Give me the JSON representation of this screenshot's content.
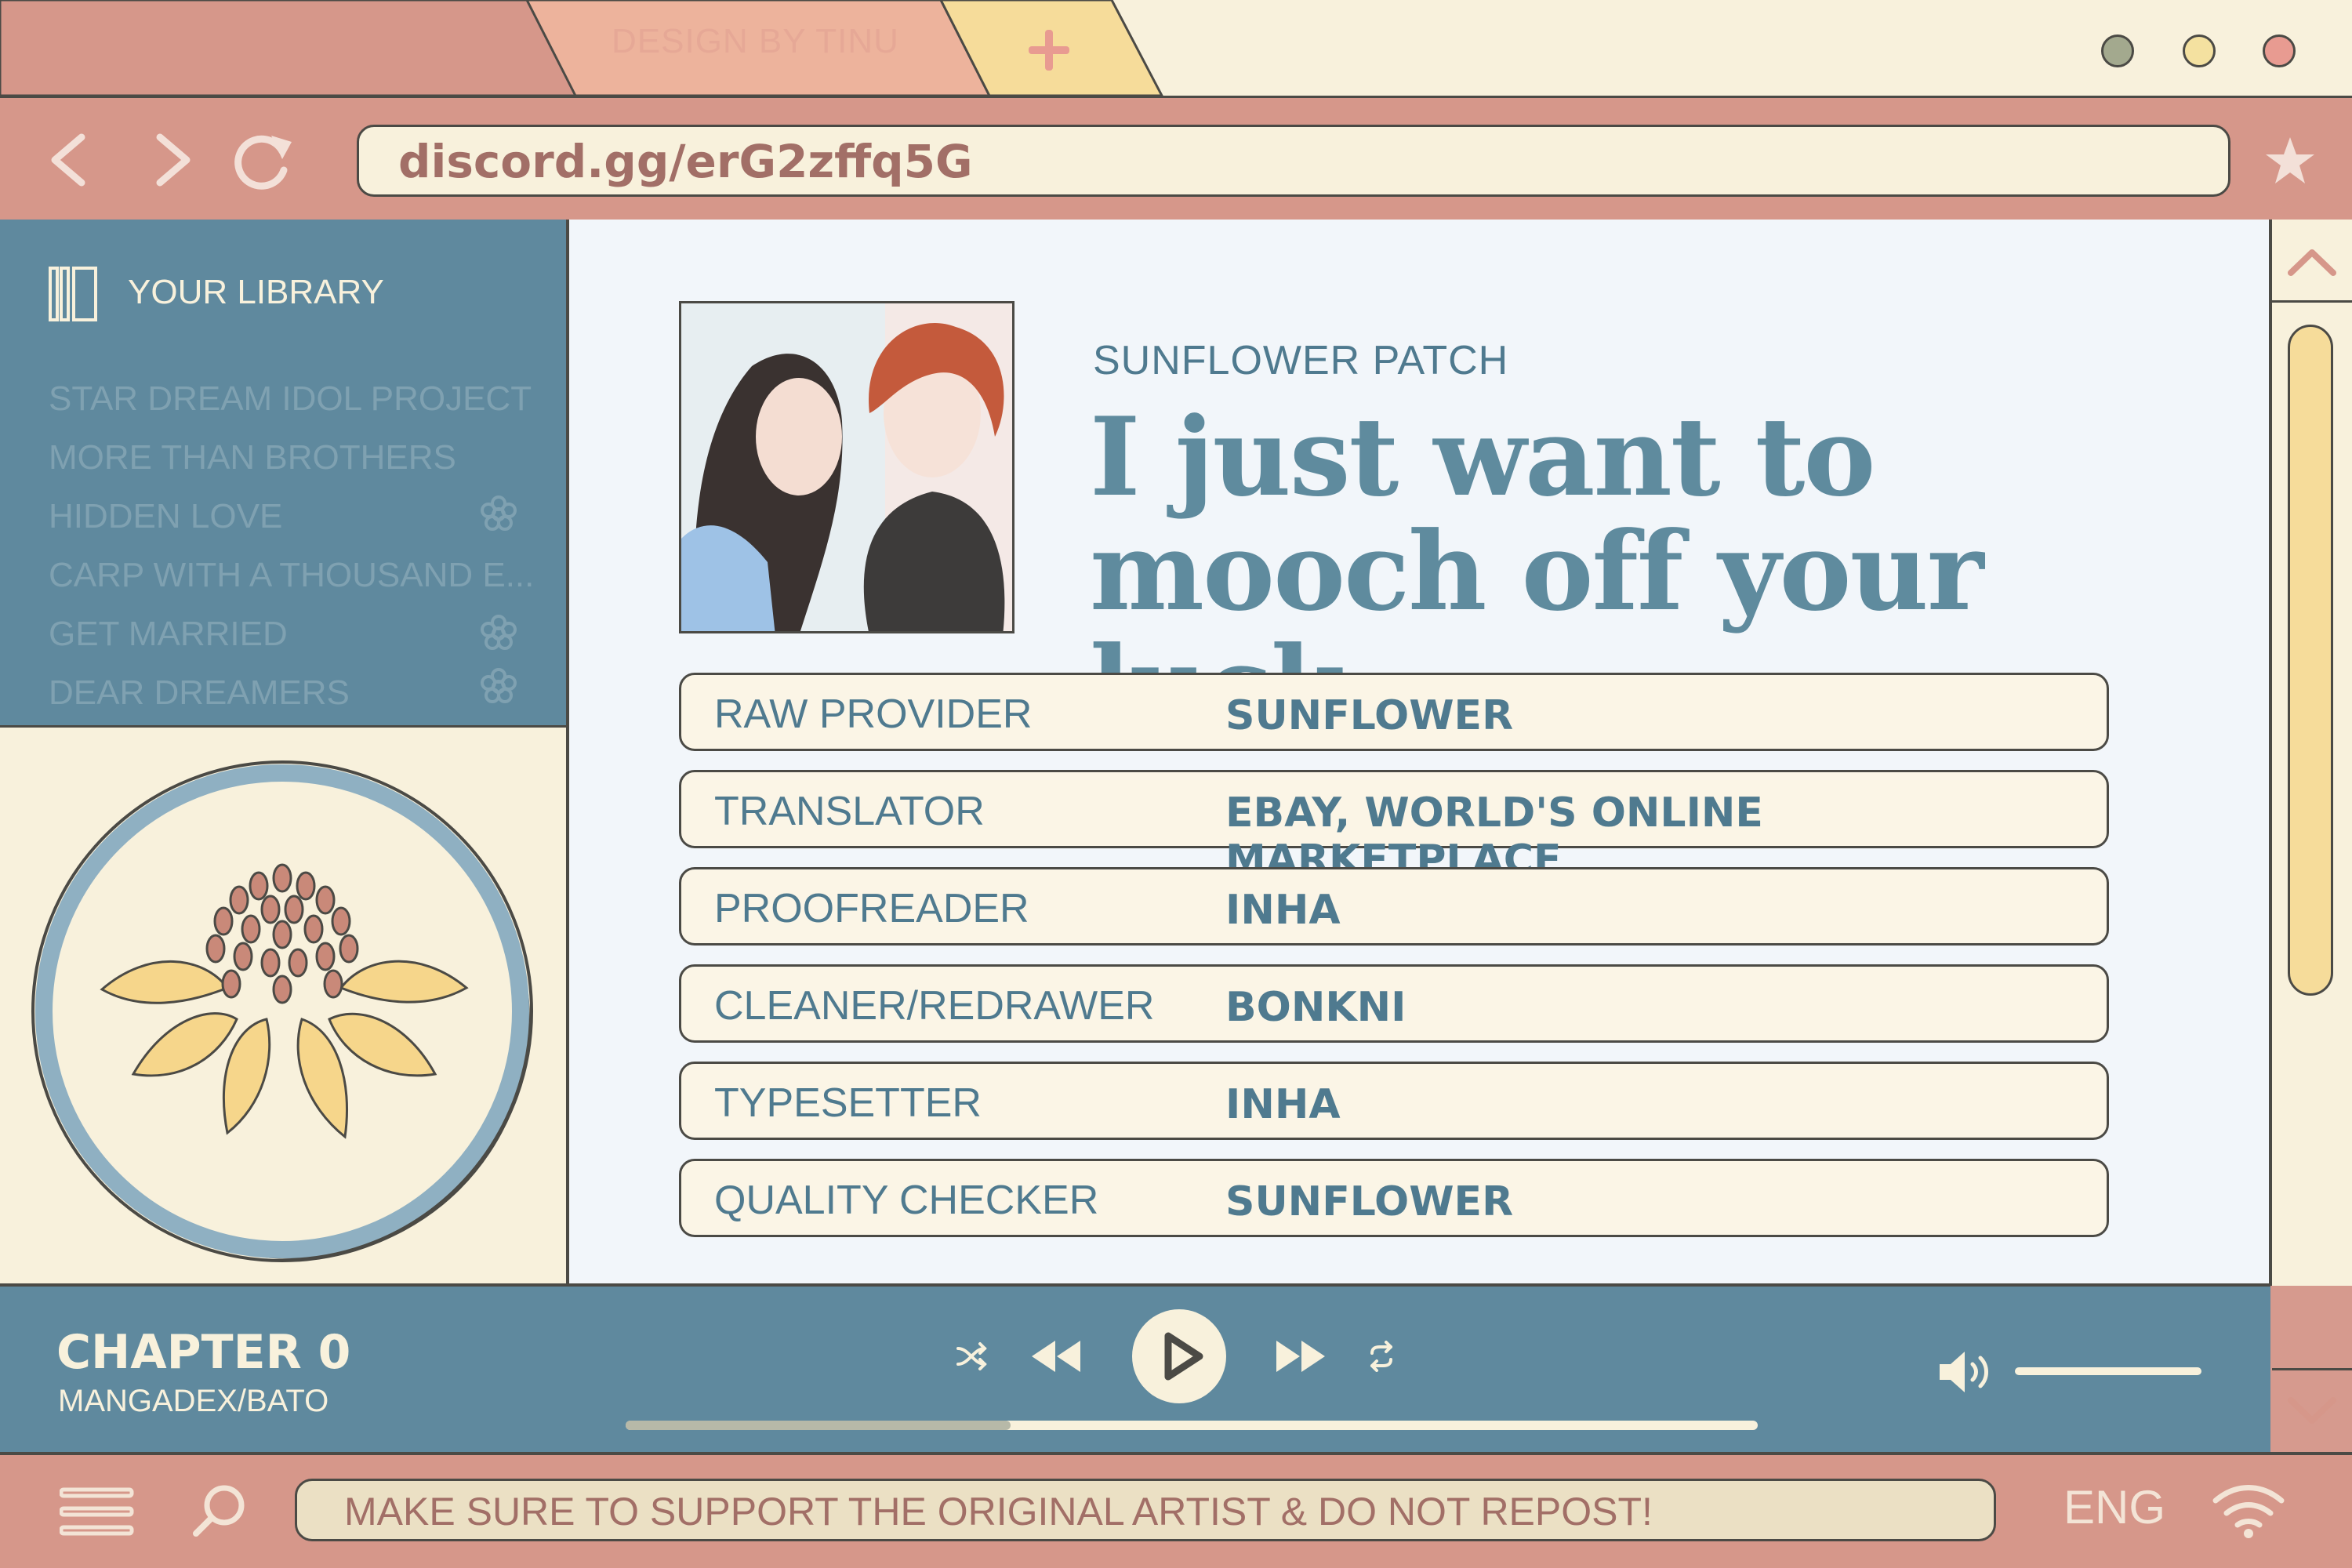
{
  "window": {
    "tab_label": "DESIGN BY TINU",
    "new_tab_symbol": "+",
    "dots": [
      "#a3a98e",
      "#f4e1a0",
      "#e89b91"
    ]
  },
  "nav": {
    "back_icon": "chevron-left-icon",
    "forward_icon": "chevron-right-icon",
    "reload_icon": "reload-icon",
    "url": "discord.gg/erG2zffq5G",
    "bookmark_icon": "star-icon"
  },
  "sidebar": {
    "title": "YOUR LIBRARY",
    "items": [
      {
        "label": "STAR DREAM IDOL PROJECT",
        "flower": false
      },
      {
        "label": "MORE THAN BROTHERS",
        "flower": false
      },
      {
        "label": "HIDDEN LOVE",
        "flower": true
      },
      {
        "label": "CARP WITH A THOUSAND E...",
        "flower": false
      },
      {
        "label": "GET MARRIED",
        "flower": true
      },
      {
        "label": "DEAR DREAMERS",
        "flower": true
      }
    ]
  },
  "main": {
    "group": "SUNFLOWER PATCH",
    "title": "I just want to mooch off your luck",
    "credits": [
      {
        "role": "RAW PROVIDER",
        "name": "SUNFLOWER"
      },
      {
        "role": "TRANSLATOR",
        "name": "EBAY, WORLD'S ONLINE MARKETPLACE"
      },
      {
        "role": "PROOFREADER",
        "name": "INHA"
      },
      {
        "role": "CLEANER/REDRAWER",
        "name": "BONKNI"
      },
      {
        "role": "TYPESETTER",
        "name": "INHA"
      },
      {
        "role": "QUALITY CHECKER",
        "name": "SUNFLOWER"
      }
    ]
  },
  "player": {
    "chapter": "CHAPTER 0",
    "source": "MANGADEX/BATO",
    "progress": 0.34,
    "volume": 1.0
  },
  "bottom": {
    "notice": "MAKE SURE TO SUPPORT THE ORIGINAL ARTIST & DO NOT REPOST!",
    "language": "ENG"
  },
  "colors": {
    "accent_blue": "#5f899e",
    "accent_rose": "#d6978a",
    "cream": "#f8f1dc",
    "sunflower": "#f6dc9a",
    "outline": "#4b4a45"
  }
}
